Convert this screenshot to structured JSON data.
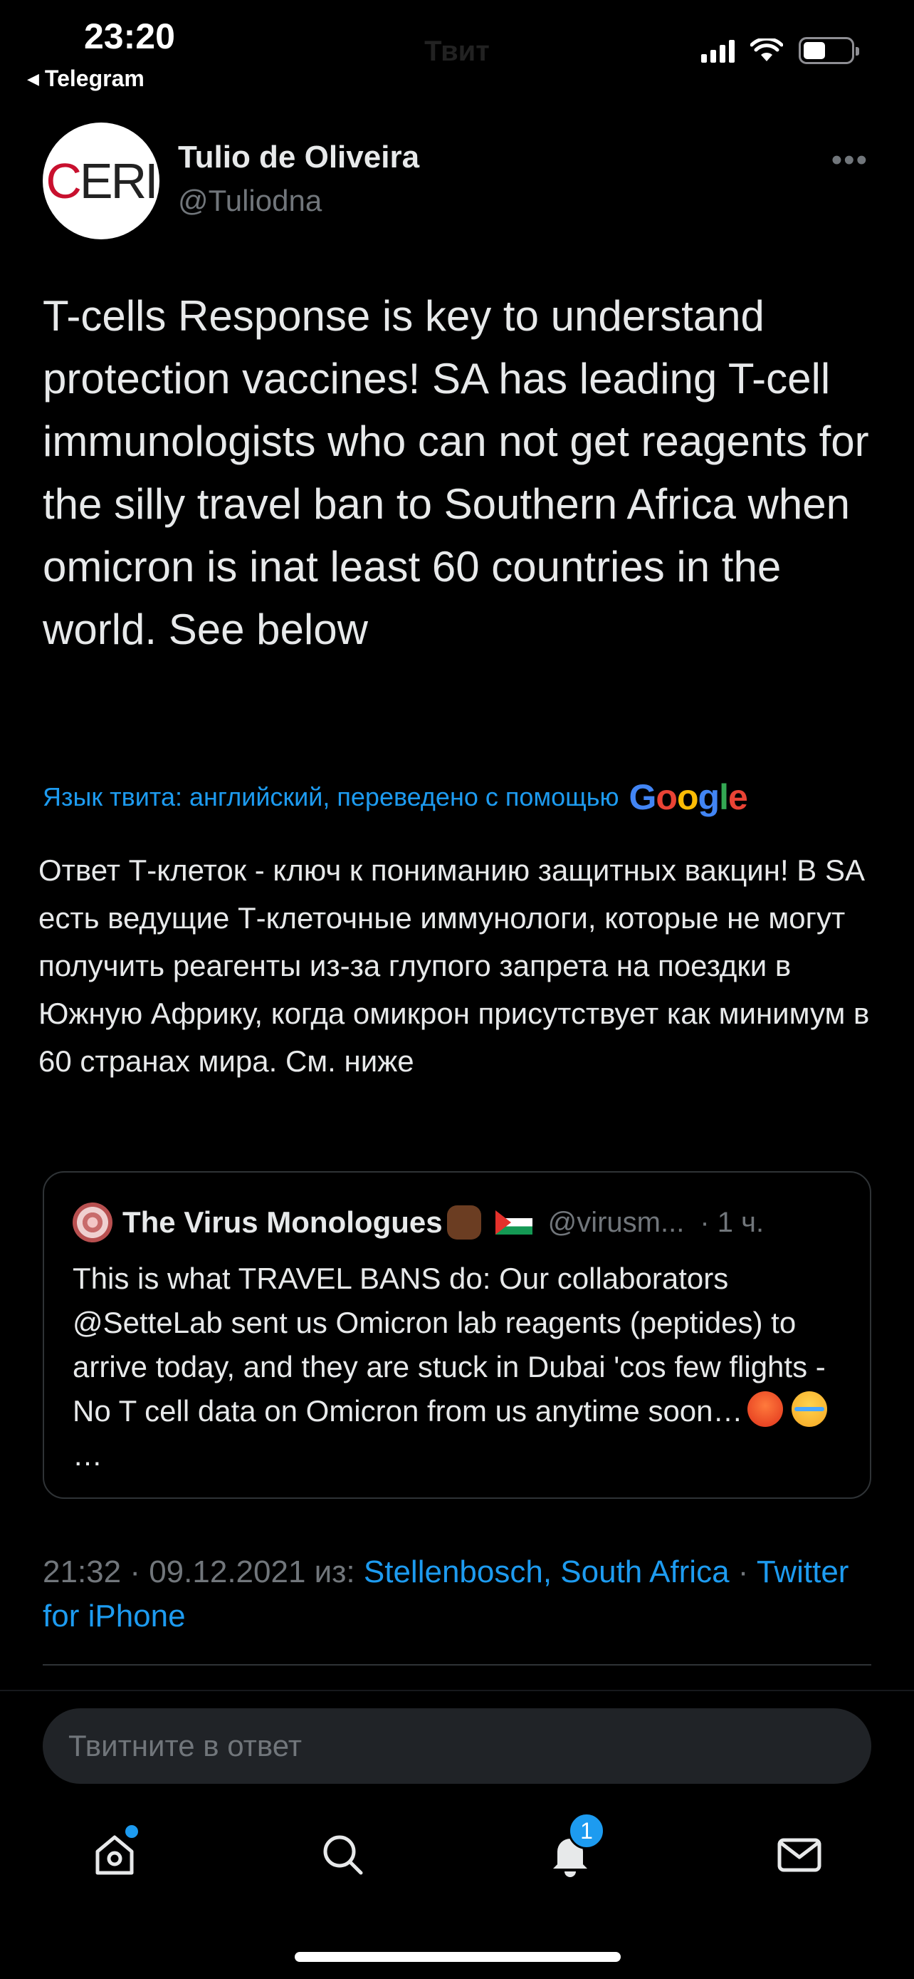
{
  "status_bar": {
    "time": "23:20",
    "back_app": "Telegram",
    "faded_title": "Твит"
  },
  "author": {
    "name": "Tulio de Oliveira",
    "handle": "@Tuliodna",
    "avatar_text": "CERI"
  },
  "tweet": {
    "text": "T-cells Response is key to understand protection vaccines! SA has leading T-cell immunologists who can not get reagents for the silly travel ban to Southern Africa when omicron is inat least  60 countries in the world. See below",
    "translation_label": "Язык твита: английский, переведено с помощью",
    "translation_provider": "Google",
    "translated_text": "Ответ Т-клеток - ключ к пониманию защитных вакцин! В SA есть ведущие Т-клеточные иммунологи, которые не могут получить реагенты из-за глупого запрета на поездки в Южную Африку, когда омикрон присутствует как минимум в 60 странах мира. См. ниже"
  },
  "quote": {
    "name": "The Virus Monologues",
    "handle": "@virusm...",
    "time": "· 1 ч.",
    "text": "This is what TRAVEL BANS do: Our collaborators @SetteLab sent us Omicron lab reagents (peptides) to arrive today, and they are stuck in Dubai 'cos few flights - No T cell data on Omicron from us anytime soon…",
    "ellipsis": "…"
  },
  "meta": {
    "timestamp": "21:32 · 09.12.2021",
    "from_label": "из:",
    "location": "Stellenbosch, South Africa",
    "separator": "·",
    "client": "Twitter for iPhone"
  },
  "reply": {
    "placeholder": "Твитните в ответ"
  },
  "tabs": {
    "notifications_badge": "1"
  },
  "colors": {
    "background": "#000000",
    "text": "#e7e9ea",
    "secondary": "#71767b",
    "accent": "#1d9bf0"
  }
}
